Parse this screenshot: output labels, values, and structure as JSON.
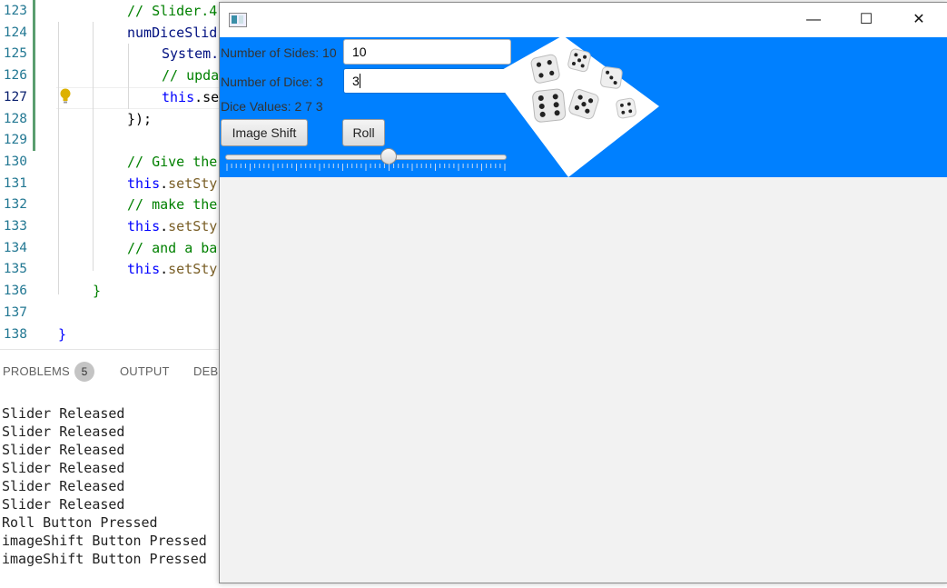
{
  "editor": {
    "lines": [
      {
        "num": "123",
        "tokens": [
          {
            "t": "// Slider.4",
            "c": "c-com"
          }
        ]
      },
      {
        "num": "124",
        "tokens": [
          {
            "t": "numDiceSlid",
            "c": "c-id"
          }
        ]
      },
      {
        "num": "125",
        "tokens": [
          {
            "t": "System.",
            "c": "c-id"
          }
        ]
      },
      {
        "num": "126",
        "tokens": [
          {
            "t": "// upda",
            "c": "c-com"
          }
        ]
      },
      {
        "num": "127",
        "tokens": [
          {
            "t": "this",
            "c": "c-kw"
          },
          {
            "t": ".se",
            "c": "c-plain"
          }
        ]
      },
      {
        "num": "128",
        "tokens": [
          {
            "t": "});",
            "c": "c-plain"
          }
        ]
      },
      {
        "num": "129",
        "tokens": []
      },
      {
        "num": "130",
        "tokens": [
          {
            "t": "// Give the",
            "c": "c-com"
          }
        ]
      },
      {
        "num": "131",
        "tokens": [
          {
            "t": "this",
            "c": "c-kw"
          },
          {
            "t": ".",
            "c": "c-plain"
          },
          {
            "t": "setSty",
            "c": "c-fn"
          }
        ]
      },
      {
        "num": "132",
        "tokens": [
          {
            "t": "// make the",
            "c": "c-com"
          }
        ]
      },
      {
        "num": "133",
        "tokens": [
          {
            "t": "this",
            "c": "c-kw"
          },
          {
            "t": ".",
            "c": "c-plain"
          },
          {
            "t": "setSty",
            "c": "c-fn"
          }
        ]
      },
      {
        "num": "134",
        "tokens": [
          {
            "t": "// and a ba",
            "c": "c-com"
          }
        ]
      },
      {
        "num": "135",
        "tokens": [
          {
            "t": "this",
            "c": "c-kw"
          },
          {
            "t": ".",
            "c": "c-plain"
          },
          {
            "t": "setSty",
            "c": "c-fn"
          }
        ]
      },
      {
        "num": "136",
        "tokens": [
          {
            "t": "}",
            "c": "c-com"
          }
        ]
      },
      {
        "num": "137",
        "tokens": []
      },
      {
        "num": "138",
        "tokens": [
          {
            "t": "}",
            "c": "c-kw"
          }
        ]
      }
    ],
    "active_line": "127"
  },
  "panel": {
    "tabs": [
      {
        "label": "PROBLEMS"
      },
      {
        "label": "OUTPUT"
      },
      {
        "label": "DEBU"
      }
    ],
    "problems_count": "5",
    "output_lines": [
      "Slider Released",
      "Slider Released",
      "Slider Released",
      "Slider Released",
      "Slider Released",
      "Slider Released",
      "Roll Button Pressed",
      "imageShift Button Pressed",
      "imageShift Button Pressed"
    ]
  },
  "window": {
    "minimize_glyph": "—",
    "maximize_glyph": "☐",
    "close_glyph": "✕",
    "sides_label": "Number of Sides: 10",
    "sides_value": "10",
    "dice_label": "Number of Dice: 3",
    "dice_value": "3",
    "dice_values_label": "Dice Values: 2 7 3",
    "image_shift_label": "Image Shift",
    "roll_label": "Roll",
    "slider_value": 0.58,
    "accent_color": "#0080ff"
  }
}
